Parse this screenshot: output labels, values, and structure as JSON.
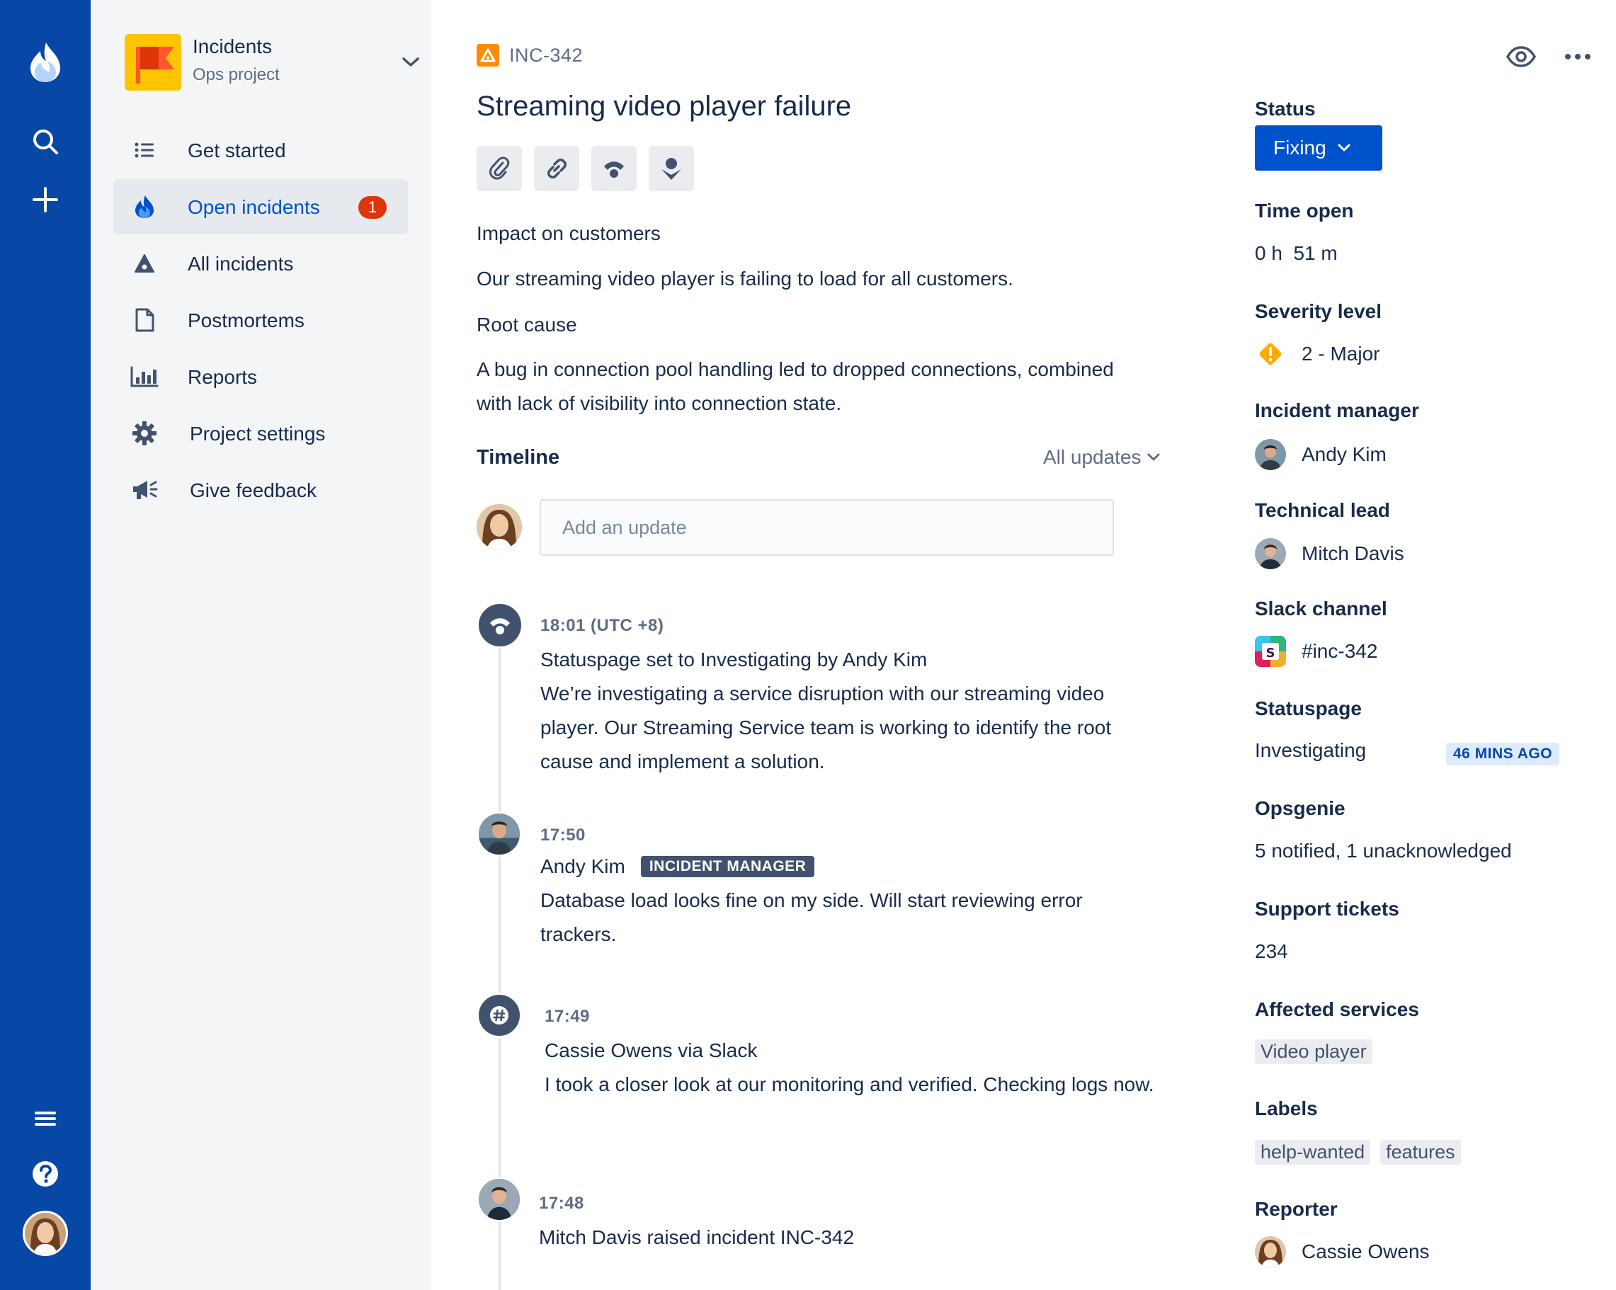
{
  "colors": {
    "nav_bg": "#0747A6",
    "sidebar_bg": "#F4F5F7",
    "primary": "#0052CC",
    "badge_red": "#DE350B",
    "incident_orange": "#FF8B00",
    "severity_yellow": "#FFAB00"
  },
  "global_nav": {
    "icons": [
      "incident-app-logo-icon",
      "search-icon",
      "plus-icon",
      "menu-icon",
      "help-icon",
      "profile-avatar"
    ]
  },
  "project": {
    "name": "Incidents",
    "type": "Ops project"
  },
  "sidebar": {
    "items": [
      {
        "label": "Get started",
        "icon": "list-icon"
      },
      {
        "label": "Open incidents",
        "icon": "flame-icon",
        "badge": "1",
        "active": true
      },
      {
        "label": "All incidents",
        "icon": "warning-triangle-icon"
      },
      {
        "label": "Postmortems",
        "icon": "document-icon"
      },
      {
        "label": "Reports",
        "icon": "bar-chart-icon"
      },
      {
        "label": "Project settings",
        "icon": "gear-icon"
      },
      {
        "label": "Give feedback",
        "icon": "megaphone-icon"
      }
    ]
  },
  "incident": {
    "key": "INC-342",
    "title": "Streaming video player failure",
    "toolbar": [
      "attach-icon",
      "link-icon",
      "statuspage-icon",
      "opsgenie-icon"
    ],
    "impact_heading": "Impact on customers",
    "impact_text": "Our streaming video player is failing to load for all customers.",
    "root_cause_heading": "Root cause",
    "root_cause_text": "A bug in connection pool handling led to dropped connections, combined with lack of visibility into connection state."
  },
  "timeline": {
    "heading": "Timeline",
    "filter": "All updates",
    "input_placeholder": "Add an update",
    "events": [
      {
        "time": "18:01 (UTC +8)",
        "title": "Statuspage set to Investigating by Andy Kim",
        "body": "We’re investigating a service disruption with our streaming video player. Our Streaming Service team is working to identify the root cause and implement a solution.",
        "icon": "statuspage-icon"
      },
      {
        "time": "17:50",
        "title": "Andy Kim",
        "badge": "INCIDENT MANAGER",
        "body": "Database load looks fine on my side. Will start reviewing error trackers.",
        "icon": "avatar"
      },
      {
        "time": "17:49",
        "title": "Cassie Owens via Slack",
        "body": "I took a closer look at our monitoring and verified. Checking logs now.",
        "icon": "slack-hash-icon"
      },
      {
        "time": "17:48",
        "title": "Mitch Davis raised incident INC-342",
        "icon": "avatar"
      }
    ]
  },
  "details": {
    "status_label": "Status",
    "status_value": "Fixing",
    "time_open_label": "Time open",
    "time_open_value": "0 h  51 m",
    "severity_label": "Severity level",
    "severity_value": "2 - Major",
    "incident_manager_label": "Incident manager",
    "incident_manager_value": "Andy Kim",
    "technical_lead_label": "Technical lead",
    "technical_lead_value": "Mitch Davis",
    "slack_label": "Slack channel",
    "slack_value": "#inc-342",
    "statuspage_label": "Statuspage",
    "statuspage_value": "Investigating",
    "statuspage_badge": "46 MINS AGO",
    "opsgenie_label": "Opsgenie",
    "opsgenie_value": "5 notified, 1 unacknowledged",
    "support_label": "Support tickets",
    "support_value": "234",
    "affected_label": "Affected services",
    "affected_values": [
      "Video player"
    ],
    "labels_label": "Labels",
    "labels_values": [
      "help-wanted",
      "features"
    ],
    "reporter_label": "Reporter",
    "reporter_value": "Cassie Owens"
  }
}
